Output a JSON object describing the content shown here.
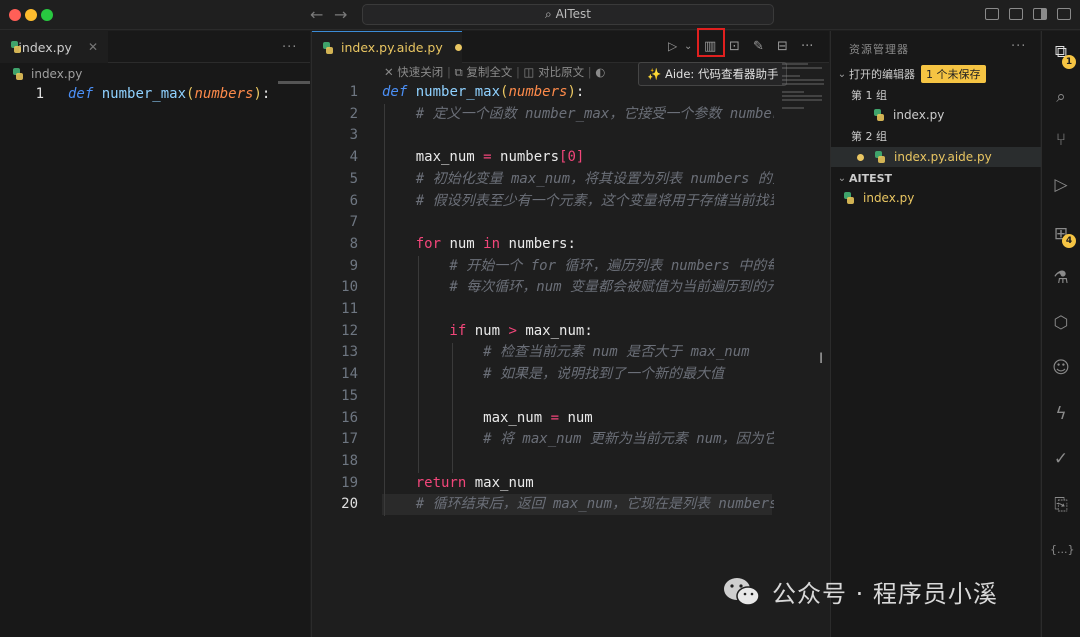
{
  "titlebar": {
    "back_icon": "arrow-left-icon",
    "forward_icon": "arrow-right-icon",
    "search_text": "AITest"
  },
  "left_editor": {
    "tab_label": "index.py",
    "breadcrumb": "index.py",
    "lines": [
      {
        "n": "1"
      }
    ]
  },
  "mid_editor": {
    "tab_label": "index.py.aide.py",
    "toolbar_items": [
      "快速关闭",
      "复制全文",
      "对比原文"
    ],
    "tooltip": "✨ Aide: 代码查看器助手",
    "line_numbers": [
      "1",
      "2",
      "3",
      "4",
      "5",
      "6",
      "7",
      "8",
      "9",
      "10",
      "11",
      "12",
      "13",
      "14",
      "15",
      "16",
      "17",
      "18",
      "19",
      "20"
    ]
  },
  "explorer": {
    "title": "资源管理器",
    "open_editors_label": "打开的编辑器",
    "unsaved_badge": "1 个未保存",
    "group1": "第 1 组",
    "group1_file": "index.py",
    "group2": "第 2 组",
    "group2_file": "index.py.aide.py",
    "folder": "AITEST",
    "folder_file": "index.py"
  },
  "activity_bar": {
    "explorer_badge": "1",
    "extensions_badge": "4",
    "json_icon_text": "{...}"
  },
  "watermark": {
    "text": "公众号 · 程序员小溪"
  },
  "colors": {
    "accent": "#3c8cd6",
    "highlight_box": "#e0201f",
    "unsaved": "#e9c662"
  }
}
